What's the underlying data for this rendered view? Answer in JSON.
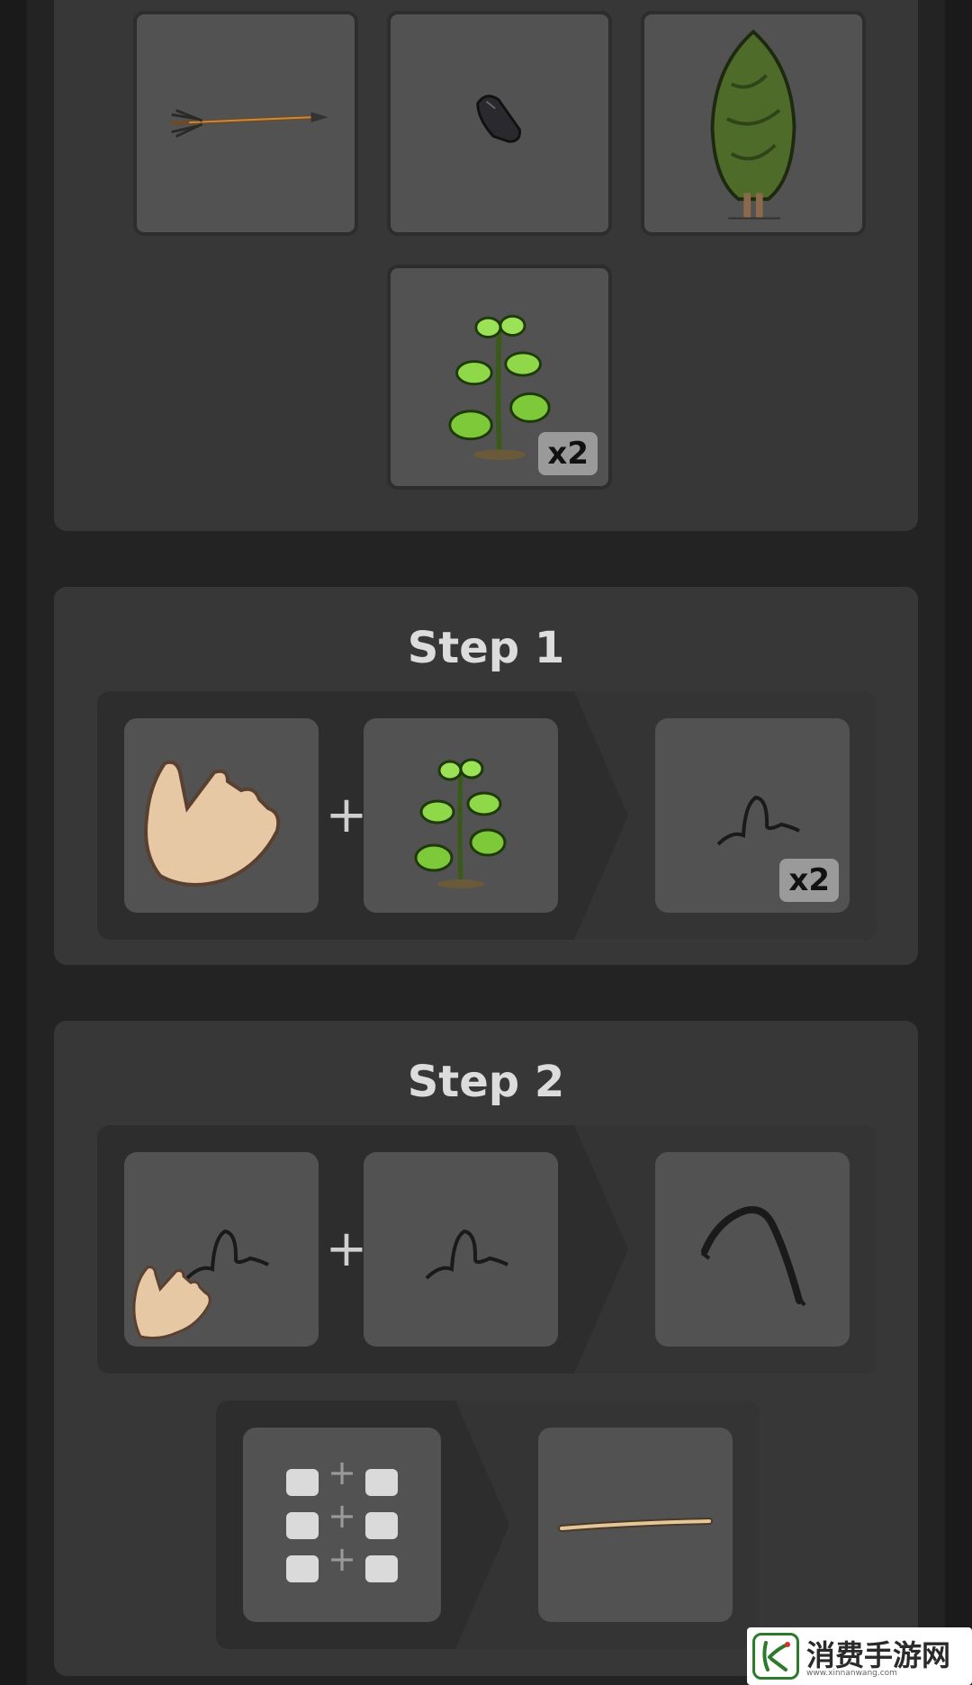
{
  "ingredients": {
    "items": [
      {
        "icon": "arrow-icon",
        "badge": ""
      },
      {
        "icon": "flint-icon",
        "badge": ""
      },
      {
        "icon": "tree-icon",
        "badge": ""
      },
      {
        "icon": "milkweed-plant-icon",
        "badge": "x2"
      }
    ]
  },
  "steps": [
    {
      "title": "Step 1",
      "inputs": [
        "bare-hand-icon",
        "milkweed-plant-icon"
      ],
      "operator": "+",
      "output": {
        "icon": "thread-icon",
        "badge": "x2"
      }
    },
    {
      "title": "Step 2",
      "inputs": [
        "thread-in-hand-icon",
        "thread-icon"
      ],
      "operator": "+",
      "output": {
        "icon": "rope-icon",
        "badge": ""
      }
    }
  ],
  "sub_recipe": {
    "input": "repeat-combine-icon",
    "operator": "+",
    "output": "long-shaft-icon"
  },
  "watermark": {
    "text": "消费手游网",
    "subtext": "www.xinnanwang.com"
  }
}
